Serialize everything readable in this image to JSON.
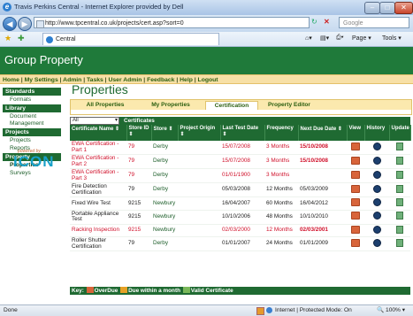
{
  "window": {
    "title": "Travis Perkins Central - Internet Explorer provided by Dell"
  },
  "browser": {
    "url": "http://www.tpcentral.co.uk/projects/cert.asp?sort=0",
    "search_placeholder": "Google",
    "tab_label": "Central",
    "page_menu": "Page",
    "tools_menu": "Tools"
  },
  "site": {
    "banner_title": "Group Property",
    "menu": [
      "Home",
      "My Settings",
      "Admin",
      "Tasks",
      "User Admin",
      "Feedback",
      "Help",
      "Logout"
    ]
  },
  "sidebar": {
    "sections": [
      {
        "header": "Standards",
        "items": [
          "Formats"
        ]
      },
      {
        "header": "Library",
        "items": [
          "Document",
          "Management"
        ]
      },
      {
        "header": "Projects",
        "items": [
          "Projects",
          "Reports"
        ]
      },
      {
        "header": "Property",
        "items": [
          "Properties",
          "Surveys"
        ]
      }
    ],
    "powered_by": "powered by",
    "logo_text": "ICON"
  },
  "main": {
    "title": "Properties",
    "tabs": [
      "All Properties",
      "My Properties",
      "Certification",
      "Property Editor"
    ],
    "selected_tab": "Certification",
    "filter_value": "All",
    "filter_label": "Certificates",
    "columns": [
      "Certificate Name",
      "Store ID",
      "Store",
      "Project Origin",
      "Last Test Date",
      "Frequency",
      "Next Due Date",
      "View",
      "History",
      "Update"
    ],
    "rows": [
      {
        "name": "EWA Certification - Part 1",
        "store_id": "79",
        "store": "Derby",
        "origin": "",
        "last": "15/07/2008",
        "freq": "3 Months",
        "next": "15/10/2008",
        "status": "overdue"
      },
      {
        "name": "EWA Certification - Part 2",
        "store_id": "79",
        "store": "Derby",
        "origin": "",
        "last": "15/07/2008",
        "freq": "3 Months",
        "next": "15/10/2008",
        "status": "overdue"
      },
      {
        "name": "EWA Certification - Part 3",
        "store_id": "79",
        "store": "Derby",
        "origin": "",
        "last": "01/01/1900",
        "freq": "3 Months",
        "next": "",
        "status": "overdue"
      },
      {
        "name": "Fire Detection Certification",
        "store_id": "79",
        "store": "Derby",
        "origin": "",
        "last": "05/03/2008",
        "freq": "12 Months",
        "next": "05/03/2009",
        "status": "ok"
      },
      {
        "name": "Fixed Wire Test",
        "store_id": "9215",
        "store": "Newbury",
        "origin": "",
        "last": "16/04/2007",
        "freq": "60 Months",
        "next": "16/04/2012",
        "status": "ok"
      },
      {
        "name": "Portable Appliance Test",
        "store_id": "9215",
        "store": "Newbury",
        "origin": "",
        "last": "10/10/2006",
        "freq": "48 Months",
        "next": "10/10/2010",
        "status": "ok"
      },
      {
        "name": "Racking Inspection",
        "store_id": "9215",
        "store": "Newbury",
        "origin": "",
        "last": "02/03/2000",
        "freq": "12 Months",
        "next": "02/03/2001",
        "status": "overdue"
      },
      {
        "name": "Roller Shutter Certification",
        "store_id": "79",
        "store": "Derby",
        "origin": "",
        "last": "01/01/2007",
        "freq": "24 Months",
        "next": "01/01/2009",
        "status": "ok"
      }
    ],
    "key_label": "Key:",
    "key_items": [
      "OverDue",
      "Due within a month",
      "Valid Certificate"
    ]
  },
  "status_bar": {
    "left": "Done",
    "zone": "Internet | Protected Mode: On",
    "zoom": "100%"
  },
  "colors": {
    "brand_green": "#1f7a3a",
    "overdue_red": "#d0102a",
    "menu_yellow": "#f7e0a6"
  }
}
